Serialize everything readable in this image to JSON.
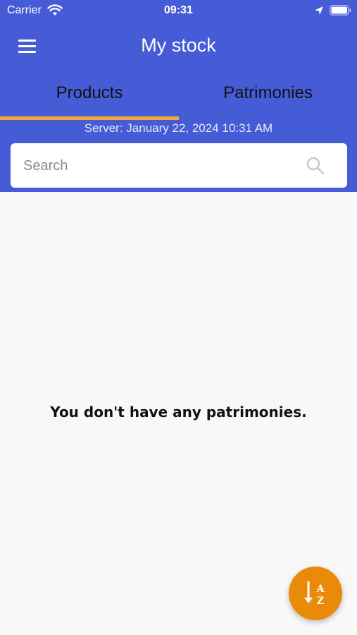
{
  "status_bar": {
    "carrier": "Carrier",
    "time": "09:31"
  },
  "header": {
    "title": "My stock",
    "menu_icon": "hamburger-menu-icon",
    "background": "#465cd6"
  },
  "tabs": [
    {
      "label": "Products",
      "active": true
    },
    {
      "label": "Patrimonies",
      "active": false
    }
  ],
  "accent_color": "#f2a73a",
  "server_line": "Server: January 22, 2024 10:31 AM",
  "search": {
    "placeholder": "Search",
    "value": "",
    "icon": "search-icon"
  },
  "empty_message": "You don't have any patrimonies.",
  "fab": {
    "icon": "sort-alpha-icon",
    "color": "#e98a08"
  }
}
